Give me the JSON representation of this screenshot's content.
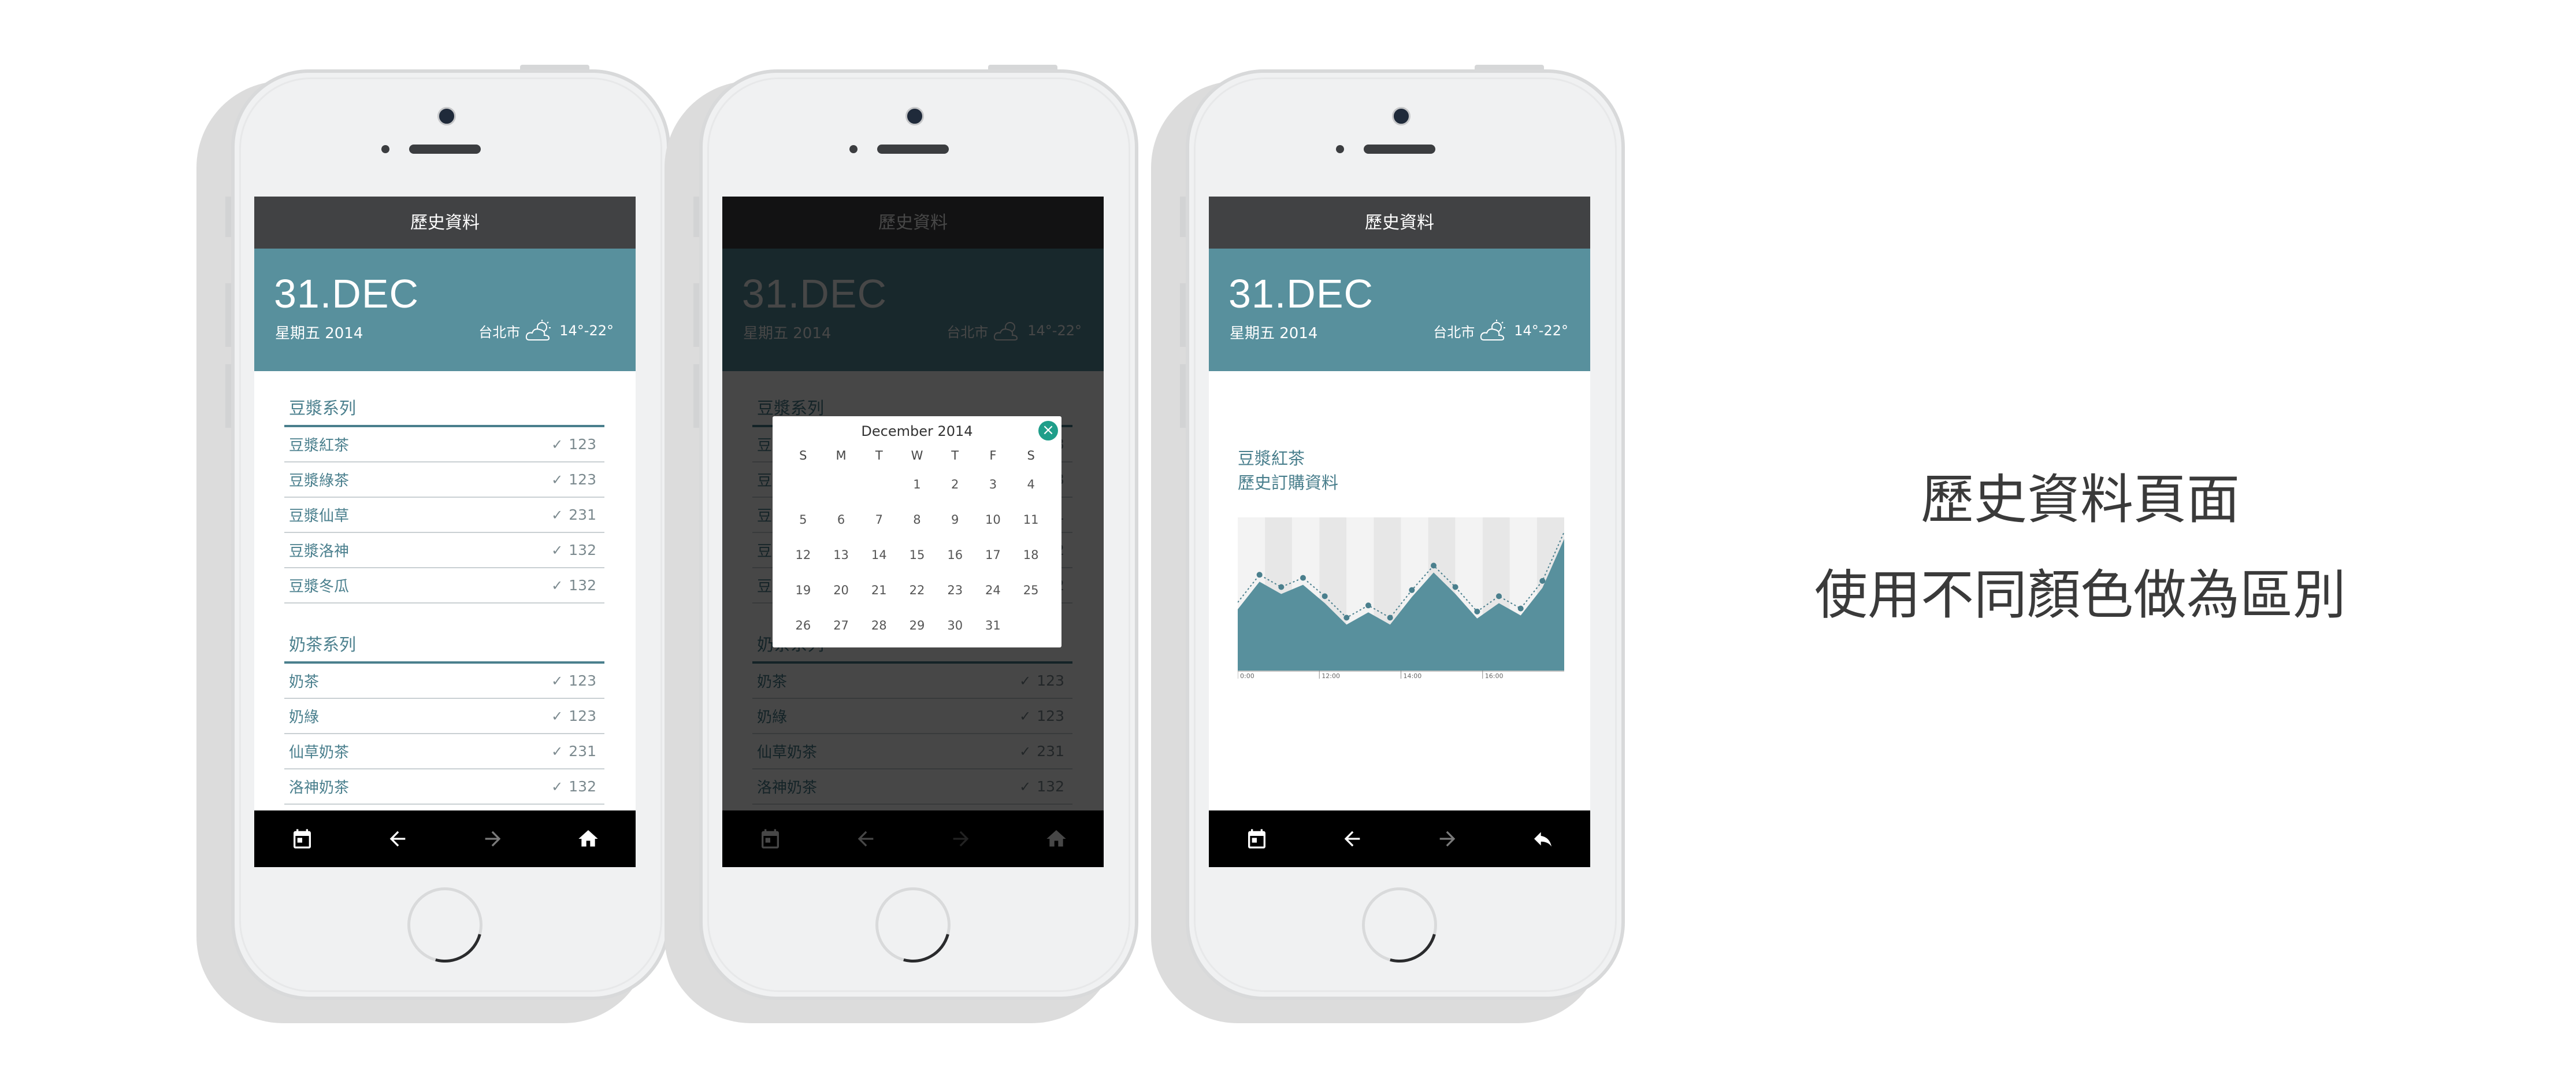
{
  "screen_title": "歷史資料",
  "hero": {
    "date_big": "31.DEC",
    "date_sub": "星期五 2014",
    "city": "台北市",
    "temp": "14°-22°"
  },
  "groups": [
    {
      "title": "豆漿系列",
      "items": [
        {
          "name": "豆漿紅茶",
          "value": "123"
        },
        {
          "name": "豆漿綠茶",
          "value": "123"
        },
        {
          "name": "豆漿仙草",
          "value": "231"
        },
        {
          "name": "豆漿洛神",
          "value": "132"
        },
        {
          "name": "豆漿冬瓜",
          "value": "132"
        }
      ]
    },
    {
      "title": "奶茶系列",
      "items": [
        {
          "name": "奶茶",
          "value": "123"
        },
        {
          "name": "奶綠",
          "value": "123"
        },
        {
          "name": "仙草奶茶",
          "value": "231"
        },
        {
          "name": "洛神奶茶",
          "value": "132"
        }
      ]
    }
  ],
  "date_picker": {
    "title": "December 2014",
    "close": "×",
    "weekdays": [
      "S",
      "M",
      "T",
      "W",
      "T",
      "F",
      "S"
    ],
    "days": [
      "",
      "",
      "",
      "1",
      "2",
      "3",
      "4",
      "5",
      "6",
      "7",
      "8",
      "9",
      "10",
      "11",
      "12",
      "13",
      "14",
      "15",
      "16",
      "17",
      "18",
      "19",
      "20",
      "21",
      "22",
      "23",
      "24",
      "25",
      "26",
      "27",
      "28",
      "29",
      "30",
      "31",
      ""
    ]
  },
  "chart_screen": {
    "title_line1": "豆漿紅茶",
    "title_line2": "歷史訂購資料"
  },
  "chart_data": {
    "type": "area",
    "x": [
      "0:00",
      "",
      "",
      "",
      "",
      "",
      "",
      "12:00",
      "",
      "",
      "14:00",
      "",
      "",
      "16:00",
      "",
      ""
    ],
    "series": [
      {
        "values": [
          40,
          58,
          50,
          56,
          44,
          30,
          38,
          30,
          48,
          64,
          50,
          34,
          44,
          36,
          54,
          86
        ]
      }
    ],
    "xticks": [
      "0:00",
      "12:00",
      "14:00",
      "16:00"
    ],
    "ylim": [
      0,
      100
    ],
    "colors": {
      "fill": "#58909d",
      "line": "#4a7f8d",
      "band_light": "#f3f3f3",
      "band_dark": "#e7e7e7"
    }
  },
  "caption": {
    "line1": "歷史資料頁面",
    "line2": "使用不同顏色做為區別"
  },
  "colors": {
    "teal": "#58909d",
    "titlebar": "#414244",
    "bottombar": "#000000"
  },
  "icons": {
    "calendar": "calendar-icon",
    "back": "arrow-left-icon",
    "forward": "arrow-right-icon",
    "home": "home-icon",
    "reply": "reply-icon",
    "weather": "sun-cloud-icon"
  }
}
